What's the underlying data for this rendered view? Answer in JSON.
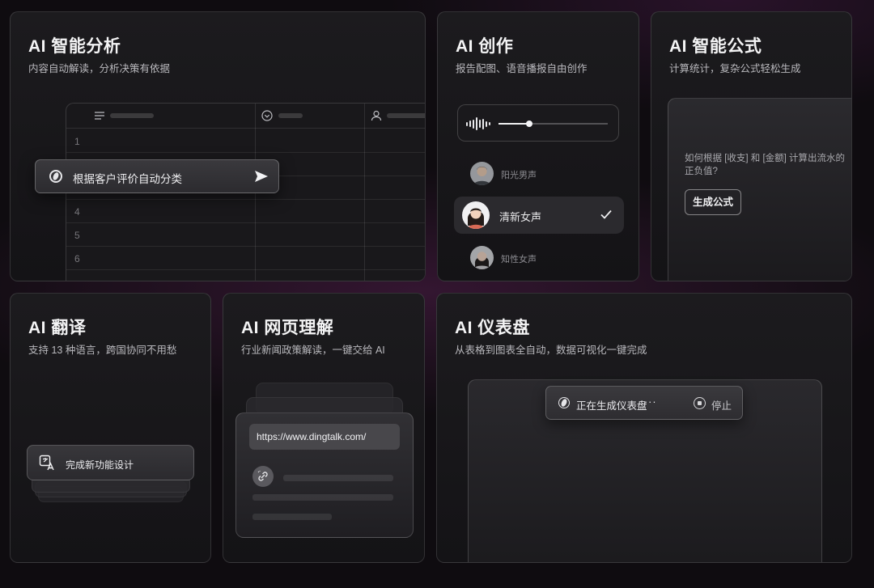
{
  "cards": {
    "analysis": {
      "title": "AI 智能分析",
      "subtitle": "内容自动解读，分析决策有依据",
      "prompt": "根据客户评价自动分类",
      "row_numbers": [
        "1",
        "4",
        "5",
        "6"
      ]
    },
    "creation": {
      "title": "AI 创作",
      "subtitle": "报告配图、语音播报自由创作",
      "audio_progress": 0.28,
      "voices": [
        {
          "label": "阳光男声",
          "selected": false
        },
        {
          "label": "清新女声",
          "selected": true
        },
        {
          "label": "知性女声",
          "selected": false
        }
      ]
    },
    "formula": {
      "title": "AI 智能公式",
      "subtitle": "计算统计，复杂公式轻松生成",
      "question": "如何根据 [收支] 和 [金额] 计算出流水的正负值?",
      "button": "生成公式"
    },
    "translate": {
      "title": "AI 翻译",
      "subtitle": "支持 13 种语言，跨国协同不用愁",
      "item": "完成新功能设计"
    },
    "web": {
      "title": "AI 网页理解",
      "subtitle": "行业新闻政策解读，一键交给 AI",
      "url": "https://www.dingtalk.com/"
    },
    "dashboard": {
      "title": "AI 仪表盘",
      "subtitle": "从表格到图表全自动，数据可视化一键完成",
      "status": "正在生成仪表盘",
      "dots": "···",
      "stop": "停止"
    }
  },
  "icons": [
    "menu-lines-icon",
    "circle-check-icon",
    "person-icon",
    "ai-logo-icon",
    "send-icon",
    "sound-wave-icon",
    "checkmark-icon",
    "translate-icon",
    "link-icon",
    "stop-icon"
  ]
}
